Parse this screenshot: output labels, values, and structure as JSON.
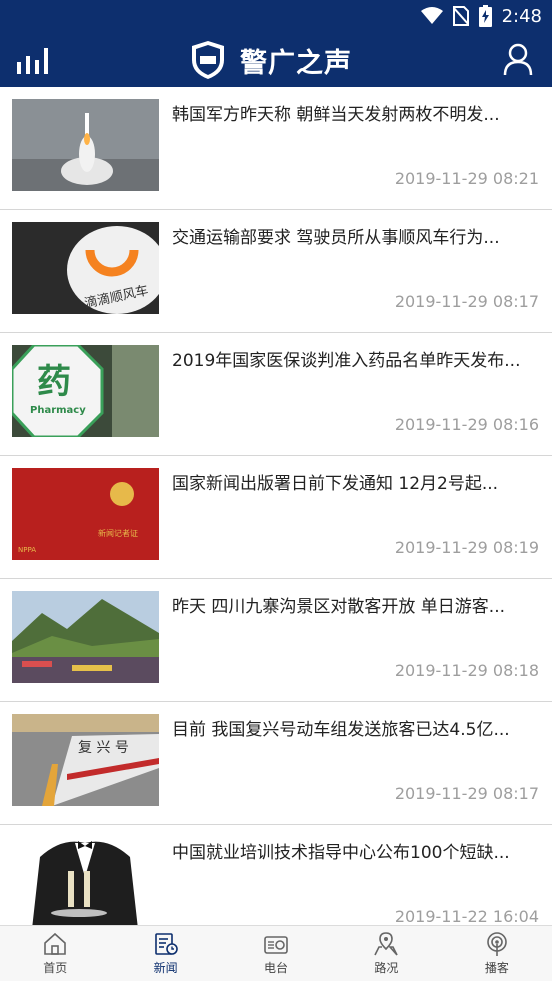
{
  "status_bar": {
    "time": "2:48"
  },
  "header": {
    "title": "警广之声",
    "logo_text": "警广之声"
  },
  "news": [
    {
      "title": "韩国军方昨天称 朝鲜当天发射两枚不明发...",
      "time": "2019-11-29 08:21",
      "thumb_icon": "missile-launch-image"
    },
    {
      "title": "交通运输部要求 驾驶员所从事顺风车行为...",
      "time": "2019-11-29 08:17",
      "thumb_icon": "didi-hitch-image",
      "thumb_text": "滴滴顺风车"
    },
    {
      "title": "2019年国家医保谈判准入药品名单昨天发布...",
      "time": "2019-11-29 08:16",
      "thumb_icon": "pharmacy-sign-image",
      "thumb_text": "药",
      "thumb_subtext": "Pharmacy"
    },
    {
      "title": "国家新闻出版署日前下发通知 12月2号起...",
      "time": "2019-11-29 08:19",
      "thumb_icon": "press-card-image",
      "thumb_text": "新闻记者证",
      "thumb_subtext": "NPPA"
    },
    {
      "title": "昨天 四川九寨沟景区对散客开放 单日游客...",
      "time": "2019-11-29 08:18",
      "thumb_icon": "jiuzhaigou-crowd-image"
    },
    {
      "title": "目前 我国复兴号动车组发送旅客已达4.5亿...",
      "time": "2019-11-29 08:17",
      "thumb_icon": "fuxing-train-image",
      "thumb_text": "复 兴 号"
    },
    {
      "title": "中国就业培训技术指导中心公布100个短缺...",
      "time": "2019-11-22 16:04",
      "thumb_icon": "waiter-image"
    }
  ],
  "bottom_nav": [
    {
      "label": "首页",
      "icon": "home-icon",
      "active": false
    },
    {
      "label": "新闻",
      "icon": "news-icon",
      "active": true
    },
    {
      "label": "电台",
      "icon": "radio-icon",
      "active": false
    },
    {
      "label": "路况",
      "icon": "traffic-map-icon",
      "active": false
    },
    {
      "label": "播客",
      "icon": "podcast-icon",
      "active": false
    }
  ],
  "colors": {
    "brand": "#0d2f6e",
    "active": "#0d2f6e",
    "time_text": "#9e9e9e"
  }
}
